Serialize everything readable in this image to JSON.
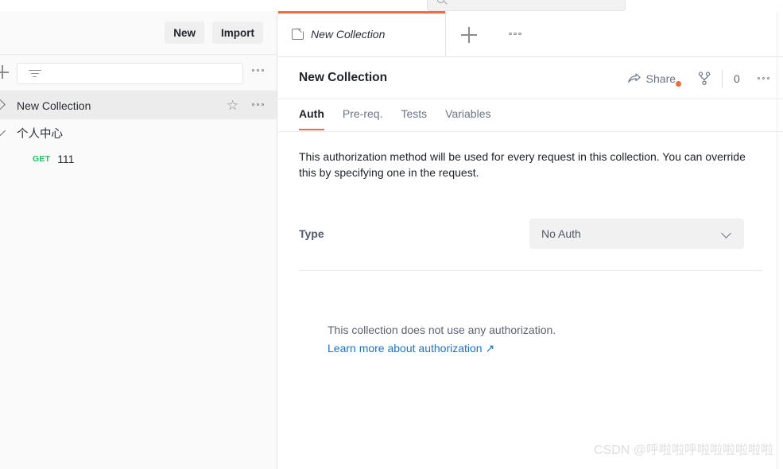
{
  "topbar": {
    "fragment_left": "",
    "fragment_mid": "",
    "search_icon": "search-icon"
  },
  "sidebar": {
    "toolbar": {
      "new_label": "New",
      "import_label": "Import",
      "more_icon": "more-options-icon"
    },
    "search": {
      "value": "",
      "placeholder": "",
      "filter_icon": "filter-funnel-icon",
      "add_icon": "plus-icon",
      "more_icon": "more-options-icon"
    },
    "tree": [
      {
        "label": "New Collection",
        "expanded": false,
        "selected": true,
        "chevron": "chevron-right-icon",
        "star_icon": "star-icon",
        "more_icon": "more-options-icon"
      },
      {
        "label": "个人中心",
        "expanded": true,
        "selected": false,
        "chevron": "chevron-down-icon"
      }
    ],
    "requests": [
      {
        "method": "GET",
        "name": "111",
        "method_color": "#22c35e"
      }
    ]
  },
  "tabbar": {
    "tab_title": "New Collection",
    "tab_icon": "collection-folder-icon",
    "new_tab_icon": "plus-icon",
    "more_icon": "more-options-icon",
    "active_accent": "#f26b3a"
  },
  "collection": {
    "name": "New Collection",
    "share_label": "Share",
    "share_icon": "share-arrow-icon",
    "share_badge": "notification-dot",
    "fork_icon": "fork-branch-icon",
    "fork_count": "0",
    "more_icon": "more-options-icon"
  },
  "tabs": [
    {
      "label": "Auth",
      "active": true
    },
    {
      "label": "Pre-req.",
      "active": false
    },
    {
      "label": "Tests",
      "active": false
    },
    {
      "label": "Variables",
      "active": false
    }
  ],
  "auth": {
    "description": "This authorization method will be used for every request in this collection. You can override this by specifying one in the request.",
    "type_label": "Type",
    "type_value": "No Auth",
    "type_chevron": "chevron-down-icon",
    "empty_text": "This collection does not use any authorization.",
    "empty_link": "Learn more about authorization ↗"
  },
  "watermark": {
    "text": "CSDN @呼啦啦呼啦啦啦啦啦啦"
  }
}
